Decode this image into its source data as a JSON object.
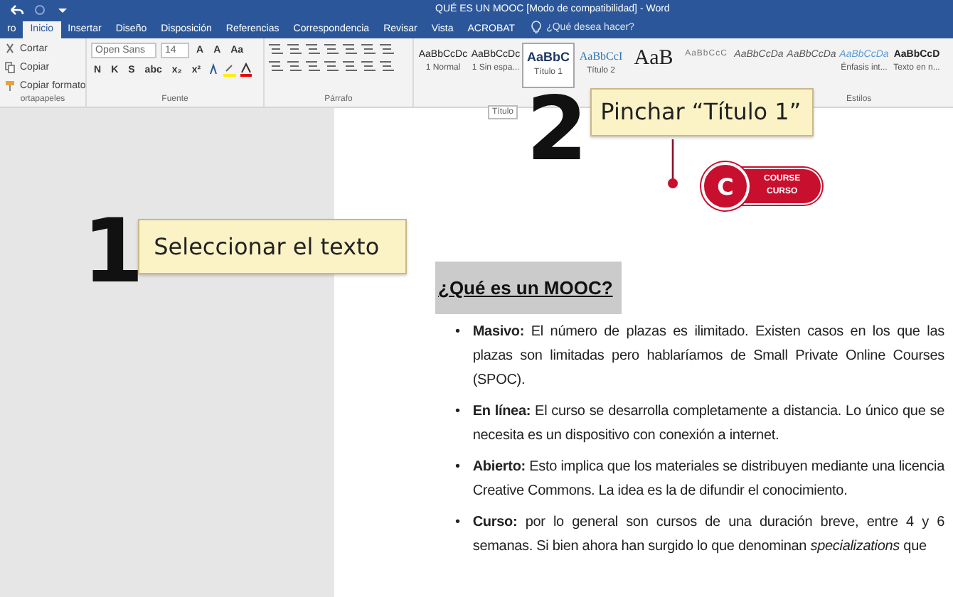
{
  "window": {
    "title": "QUÉ ES UN MOOC [Modo de compatibilidad] - Word"
  },
  "tabs": [
    {
      "label": "ro",
      "selected": false
    },
    {
      "label": "Inicio",
      "selected": true
    },
    {
      "label": "Insertar",
      "selected": false
    },
    {
      "label": "Diseño",
      "selected": false
    },
    {
      "label": "Disposición",
      "selected": false
    },
    {
      "label": "Referencias",
      "selected": false
    },
    {
      "label": "Correspondencia",
      "selected": false
    },
    {
      "label": "Revisar",
      "selected": false
    },
    {
      "label": "Vista",
      "selected": false
    },
    {
      "label": "ACROBAT",
      "selected": false
    }
  ],
  "tell_me": {
    "placeholder": "¿Qué desea hacer?"
  },
  "ribbon": {
    "clipboard": {
      "items": [
        {
          "label": "Cortar",
          "kind": "cut"
        },
        {
          "label": "Copiar",
          "kind": "copy"
        },
        {
          "label": "Copiar formato",
          "kind": "painter"
        }
      ],
      "label": "ortapapeles"
    },
    "font": {
      "name": "Open Sans",
      "size": "14",
      "tools": [
        "A",
        "A",
        "Aa"
      ],
      "format_buttons": [
        "N",
        "K",
        "S",
        "abc",
        "x₂",
        "x²"
      ],
      "label": "Fuente"
    },
    "paragraph": {
      "label": "Párrafo"
    },
    "styles": {
      "label": "Estilos",
      "items": [
        {
          "preview": "AaBbCcDc",
          "caption": "1 Normal",
          "kind": "normal",
          "selected": false
        },
        {
          "preview": "AaBbCcDc",
          "caption": "1 Sin espa...",
          "kind": "normal",
          "selected": false
        },
        {
          "preview": "AaBbC",
          "caption": "Título 1",
          "kind": "heading1",
          "selected": true
        },
        {
          "preview": "AaBbCcI",
          "caption": "Título 2",
          "kind": "heading2",
          "selected": false
        },
        {
          "preview": "AaB",
          "kind": "title",
          "selected": false
        },
        {
          "preview": "AaBbCcC",
          "kind": "subtitle",
          "selected": false
        },
        {
          "preview": "AaBbCcDa",
          "kind": "emphasis",
          "selected": false
        },
        {
          "preview": "AaBbCcDa",
          "kind": "emphasis",
          "selected": false
        },
        {
          "preview": "AaBbCcDa",
          "caption": "Énfasis int...",
          "kind": "intense",
          "selected": false
        },
        {
          "preview": "AaBbCcD",
          "caption": "Texto en n...",
          "kind": "strong",
          "selected": false
        }
      ]
    }
  },
  "tooltip": {
    "text": "Título"
  },
  "callouts": [
    {
      "number": "1",
      "text": "Seleccionar el texto"
    },
    {
      "number": "2",
      "text": "Pinchar “Título 1”"
    }
  ],
  "logo": {
    "initial": "C",
    "lines": [
      "COURSE",
      "CURSO"
    ]
  },
  "document": {
    "heading": "¿Qué es un MOOC?",
    "heading_selected": true,
    "items": [
      {
        "marker": "•",
        "lead": "Masivo:",
        "text": "El número de plazas es ilimitado. Existen casos en los que las plazas son limitadas pero hablaríamos de Small Private Online Courses (SPOC)."
      },
      {
        "marker": "•",
        "lead": "En línea:",
        "text": "El curso se desarrolla completamente a distancia. Lo único que se necesita es un dispositivo con conexión a internet."
      },
      {
        "marker": "•",
        "lead": "Abierto:",
        "text": "Esto implica que los materiales se distribuyen mediante una licencia Creative Commons. La idea es la de difundir el conocimiento."
      },
      {
        "marker": "•",
        "lead": "Curso:",
        "text": "por lo general son cursos de una duración breve, entre 4 y 6 semanas. Si bien ahora han surgido lo que denominan *specializations* que"
      }
    ]
  }
}
